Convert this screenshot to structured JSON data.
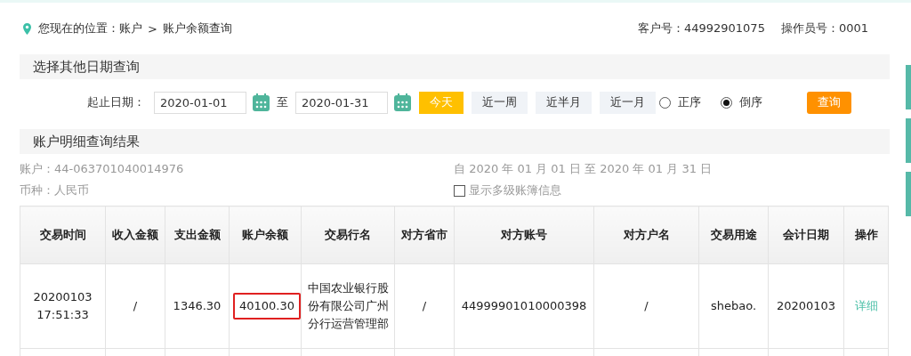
{
  "breadcrumb": {
    "prefix": "您现在的位置：",
    "separator": ">",
    "items": [
      "账户",
      "账户余额查询"
    ]
  },
  "header_info": [
    "客户号：44992901075",
    "操作员号：0001"
  ],
  "date_query": {
    "title": "选择其他日期查询",
    "label": "起止日期：",
    "start": "2020-01-01",
    "to": "至",
    "end": "2020-01-31",
    "quick_ranges": [
      {
        "label": "今天",
        "selected": true
      },
      {
        "label": "近一周",
        "selected": false
      },
      {
        "label": "近半月",
        "selected": false
      },
      {
        "label": "近一月",
        "selected": false
      }
    ],
    "order": [
      {
        "label": "正序",
        "selected": false
      },
      {
        "label": "倒序",
        "selected": true
      }
    ],
    "search_button": "查询"
  },
  "results": {
    "title": "账户明细查询结果",
    "account": "账户：44-063701040014976",
    "period": "自 2020 年 01 月 01 日 至 2020 年 01 月 31 日",
    "currency": "币种：人民币",
    "multi_ledger": {
      "label": "显示多级账簿信息",
      "checked": false
    }
  },
  "table": {
    "columns": [
      "交易时间",
      "收入金额",
      "支出金额",
      "账户余额",
      "交易行名",
      "对方省市",
      "对方账号",
      "对方户名",
      "交易用途",
      "会计日期",
      "操作"
    ],
    "rows": [
      {
        "cells": [
          {
            "text": "20200103 17:51:33",
            "highlighted": false
          },
          {
            "text": "/",
            "highlighted": false
          },
          {
            "text": "1346.30",
            "highlighted": false
          },
          {
            "text": "40100.30",
            "highlighted": true
          },
          {
            "text": "中国农业银行股份有限公司广州分行运营管理部",
            "highlighted": false
          },
          {
            "text": "/",
            "highlighted": false
          },
          {
            "text": "44999901010000398",
            "highlighted": false
          },
          {
            "text": "/",
            "highlighted": false
          },
          {
            "text": "shebao.",
            "highlighted": false
          },
          {
            "text": "20200103",
            "highlighted": false
          }
        ],
        "action": "详细"
      }
    ]
  }
}
